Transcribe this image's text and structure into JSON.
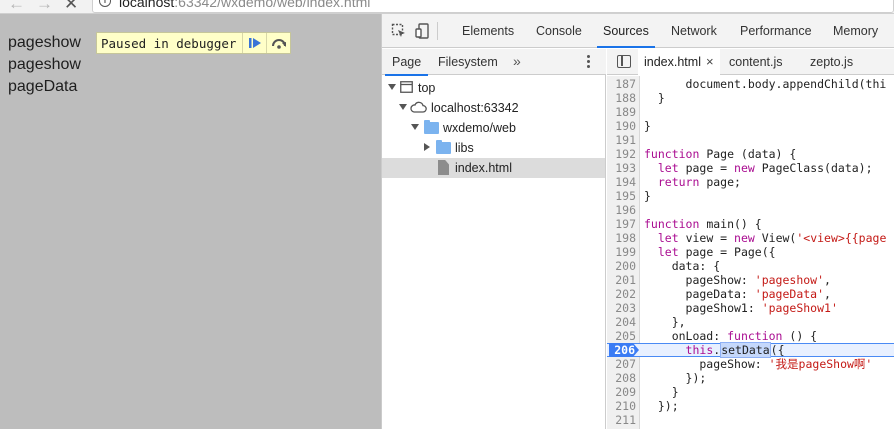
{
  "browser": {
    "url_host": "localhost",
    "url_path": ":63342/wxdemo/web/index.html",
    "back_icon": "arrow-left-icon",
    "forward_icon": "arrow-right-icon",
    "reload_icon": "close-x-icon"
  },
  "page": {
    "lines": [
      "pageshow",
      "pageshow",
      "pageData"
    ],
    "paused_label": "Paused in debugger",
    "resume_icon": "resume-icon",
    "step_over_icon": "step-over-icon",
    "dim_color": "#bdbdbd",
    "badge_color": "#ffffc8"
  },
  "devtools": {
    "tabs": [
      "Elements",
      "Console",
      "Sources",
      "Network",
      "Performance",
      "Memory"
    ],
    "active_tab": "Sources",
    "accent_color": "#1a73e8",
    "navigator": {
      "tabs": [
        "Page",
        "Filesystem"
      ],
      "active_tab": "Page",
      "more_label": "»",
      "tree": [
        {
          "label": "top",
          "icon": "frame-icon"
        },
        {
          "label": "localhost:63342",
          "icon": "cloud-icon"
        },
        {
          "label": "wxdemo/web",
          "icon": "folder-icon"
        },
        {
          "label": "libs",
          "icon": "folder-icon"
        },
        {
          "label": "index.html",
          "icon": "file-icon"
        }
      ]
    },
    "editor": {
      "tabs": [
        "index.html",
        "content.js",
        "zepto.js"
      ],
      "active_tab": "index.html",
      "close_label": "×",
      "paused_line": "206",
      "lines": [
        {
          "n": "187",
          "code": "      document.body.appendChild(thi"
        },
        {
          "n": "188",
          "code": "  }"
        },
        {
          "n": "189",
          "code": ""
        },
        {
          "n": "190",
          "code": "}"
        },
        {
          "n": "191",
          "code": ""
        },
        {
          "n": "192",
          "code": "function Page (data) {"
        },
        {
          "n": "193",
          "code": "  let page = new PageClass(data);"
        },
        {
          "n": "194",
          "code": "  return page;"
        },
        {
          "n": "195",
          "code": "}"
        },
        {
          "n": "196",
          "code": ""
        },
        {
          "n": "197",
          "code": "function main() {"
        },
        {
          "n": "198",
          "code": "  let view = new View('<view>{{page"
        },
        {
          "n": "199",
          "code": "  let page = Page({"
        },
        {
          "n": "200",
          "code": "    data: {"
        },
        {
          "n": "201",
          "code": "      pageShow: 'pageshow',"
        },
        {
          "n": "202",
          "code": "      pageData: 'pageData',"
        },
        {
          "n": "203",
          "code": "      pageShow1: 'pageShow1'"
        },
        {
          "n": "204",
          "code": "    },"
        },
        {
          "n": "205",
          "code": "    onLoad: function () {"
        },
        {
          "n": "206",
          "code": "      this.setData({"
        },
        {
          "n": "207",
          "code": "        pageShow: '我是pageShow啊'"
        },
        {
          "n": "208",
          "code": "      });"
        },
        {
          "n": "209",
          "code": "    }"
        },
        {
          "n": "210",
          "code": "  });"
        },
        {
          "n": "211",
          "code": ""
        }
      ]
    }
  }
}
